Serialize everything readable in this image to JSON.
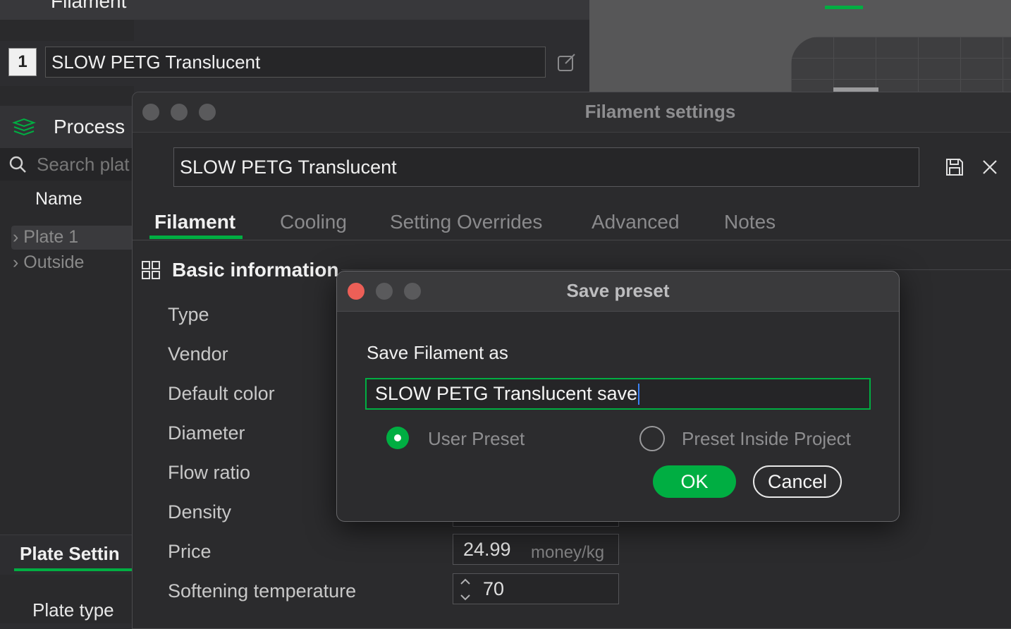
{
  "app": {
    "panel_title": "Filament"
  },
  "preset_bar": {
    "index": "1",
    "preset_name": "SLOW PETG Translucent"
  },
  "left_panel": {
    "process_label": "Process",
    "search_placeholder": "Search plat",
    "name_header": "Name",
    "tree": [
      {
        "label": "Plate 1"
      },
      {
        "label": "Outside"
      }
    ],
    "plate_settings_label": "Plate Settin",
    "plate_type_label": "Plate type"
  },
  "filament_settings": {
    "title": "Filament settings",
    "preset_name": "SLOW PETG Translucent",
    "tabs": [
      {
        "label": "Filament",
        "active": true
      },
      {
        "label": "Cooling"
      },
      {
        "label": "Setting Overrides"
      },
      {
        "label": "Advanced"
      },
      {
        "label": "Notes"
      }
    ],
    "section_title": "Basic information",
    "fields": [
      {
        "label": "Type"
      },
      {
        "label": "Vendor"
      },
      {
        "label": "Default color"
      },
      {
        "label": "Diameter"
      },
      {
        "label": "Flow ratio"
      },
      {
        "label": "Density"
      },
      {
        "label": "Price",
        "value": "24.99",
        "unit": "money/kg"
      },
      {
        "label": "Softening temperature",
        "value": "70"
      }
    ]
  },
  "save_dialog": {
    "title": "Save preset",
    "label": "Save Filament as",
    "input_value": "SLOW PETG Translucent save",
    "options": [
      {
        "label": "User Preset",
        "selected": true
      },
      {
        "label": "Preset Inside Project",
        "selected": false
      }
    ],
    "ok_label": "OK",
    "cancel_label": "Cancel"
  },
  "colors": {
    "accent": "#00ae42",
    "close_red": "#ec5f57"
  }
}
